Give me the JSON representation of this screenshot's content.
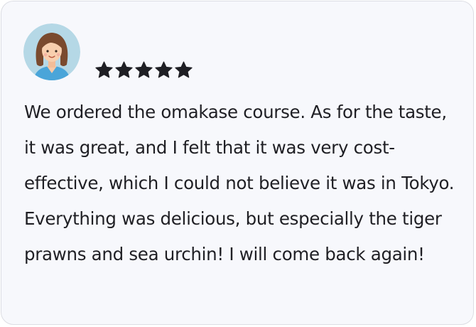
{
  "review": {
    "avatar_icon": "female-user-avatar-icon",
    "rating": 5,
    "rating_max": 5,
    "star_icon": "star-icon",
    "star_color": "#1f1f24",
    "text": "We ordered the omakase course. As for the taste, it was great, and I felt that it was very cost-effective, which I could not believe it was in Tokyo. Everything was delicious, but especially the tiger prawns and sea urchin! I will come back again!"
  }
}
